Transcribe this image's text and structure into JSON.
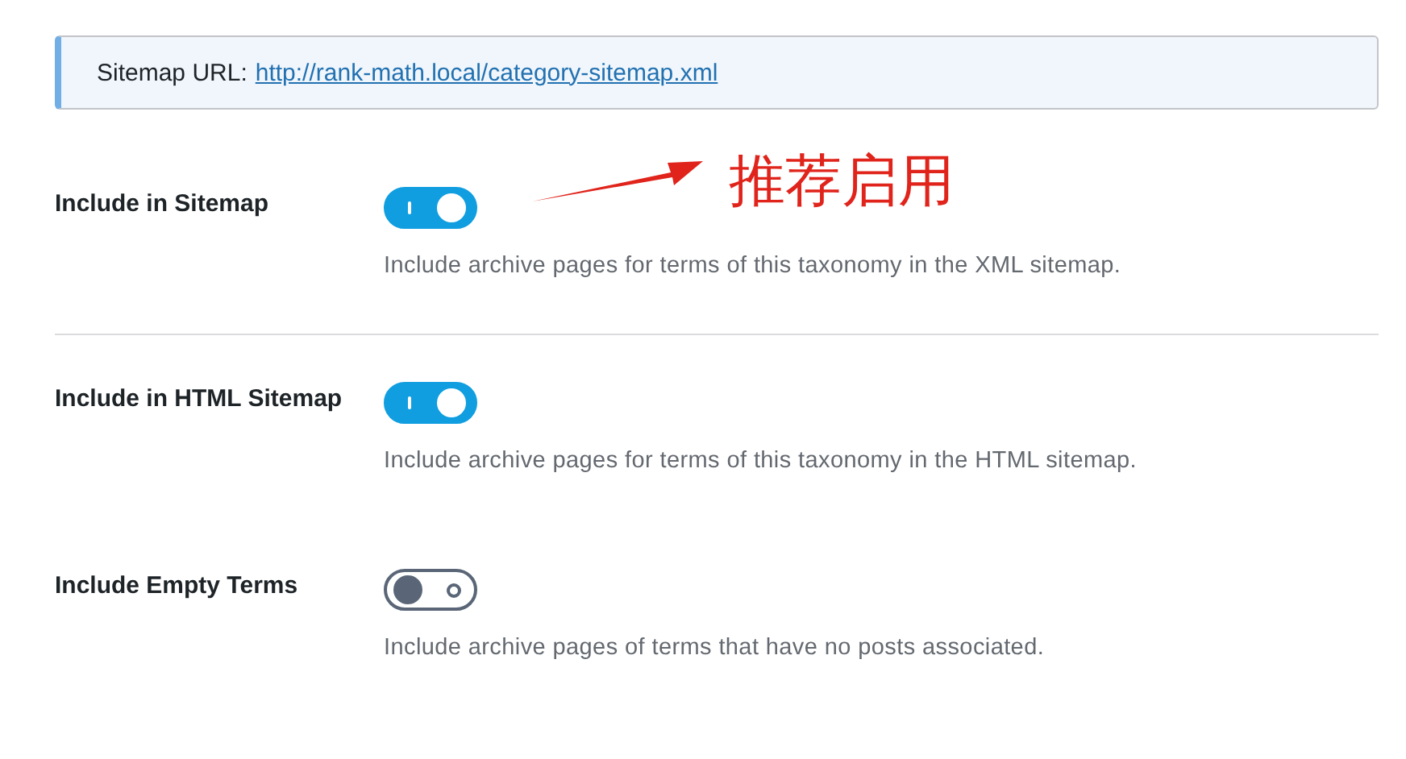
{
  "notice": {
    "label": "Sitemap URL:",
    "link": "http://rank-math.local/category-sitemap.xml"
  },
  "annotation": {
    "text": "推荐启用"
  },
  "settings": [
    {
      "label": "Include in Sitemap",
      "on": true,
      "description": "Include archive pages for terms of this taxonomy in the XML sitemap.",
      "divider_below": true
    },
    {
      "label": "Include in HTML Sitemap",
      "on": true,
      "description": "Include archive pages for terms of this taxonomy in the HTML sitemap.",
      "divider_below": false
    },
    {
      "label": "Include Empty Terms",
      "on": false,
      "description": "Include archive pages of terms that have no posts associated.",
      "divider_below": false
    }
  ]
}
